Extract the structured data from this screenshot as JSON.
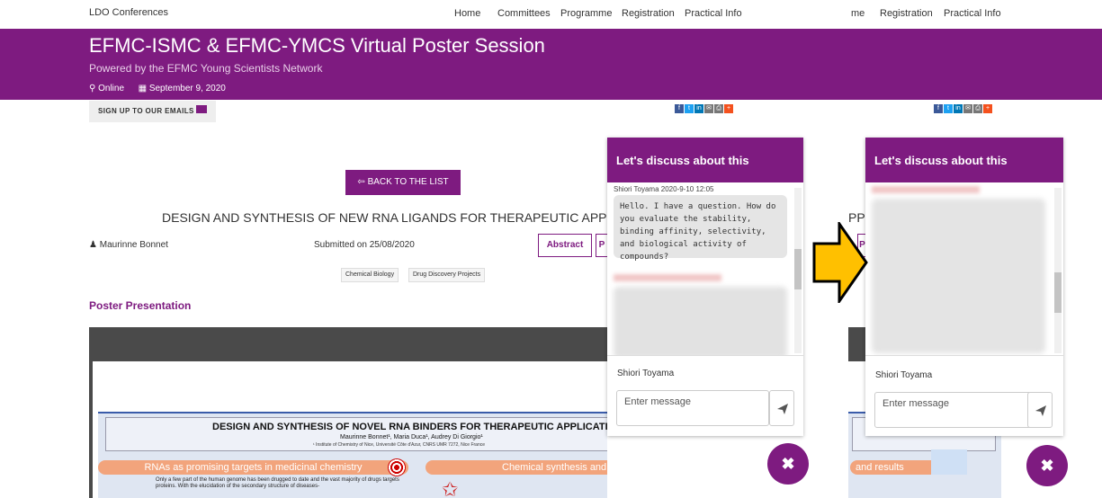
{
  "nav": {
    "brand": "LDO Conferences",
    "links": [
      "Home",
      "Committees",
      "Programme",
      "Registration",
      "Practical Info"
    ],
    "links_right": [
      "me",
      "Registration",
      "Practical Info"
    ]
  },
  "banner": {
    "title": "EFMC-ISMC & EFMC-YMCS Virtual Poster Session",
    "subtitle": "Powered by the EFMC Young Scientists Network",
    "location": "Online",
    "date": "September 9, 2020"
  },
  "signup_label": "SIGN UP TO OUR EMAILS",
  "back_label": "BACK TO THE LIST",
  "poster": {
    "title": "DESIGN AND SYNTHESIS OF NEW RNA LIGANDS FOR THERAPEUTIC APPLICATIONS",
    "title_right_fragment": "PPI",
    "author": "Maurinne Bonnet",
    "submitted": "Submitted on 25/08/2020",
    "tab_abstract": "Abstract",
    "tab_next": "P",
    "tags": [
      "Chemical Biology",
      "Drug Discovery Projects"
    ],
    "section_title": "Poster Presentation",
    "content": {
      "heading": "DESIGN AND SYNTHESIS OF NOVEL RNA BINDERS FOR THERAPEUTIC APPLICATIONS",
      "authors": "Maurinne Bonnet¹, Maria Duca¹, Audrey Di Giorgio¹",
      "affiliation": "¹ Institute of Chemistry of Nice, Université Côte d'Azur, CNRS UMR 7272, Nice France",
      "section_left": "RNAs as promising targets in medicinal chemistry",
      "section_right": "Chemical synthesis and results",
      "section_right_fragment": "and results",
      "text": "Only a few part of the human genome has been drugged to date and the vast majority of drugs targets proteins. With the elucidation of the secondary structure of diseases-"
    }
  },
  "chat": {
    "header": "Let's discuss about this",
    "message_meta": "Shiori Toyama 2020-9-10 12:05",
    "message_text": "Hello. I have a question. How do you evaluate the stability, binding affinity, selectivity, and biological activity of compounds?",
    "user": "Shiori Toyama",
    "input_placeholder": "Enter message",
    "close_symbol": "✖"
  },
  "colors": {
    "brand_purple": "#7e1b80",
    "arrow_yellow": "#ffc000"
  }
}
